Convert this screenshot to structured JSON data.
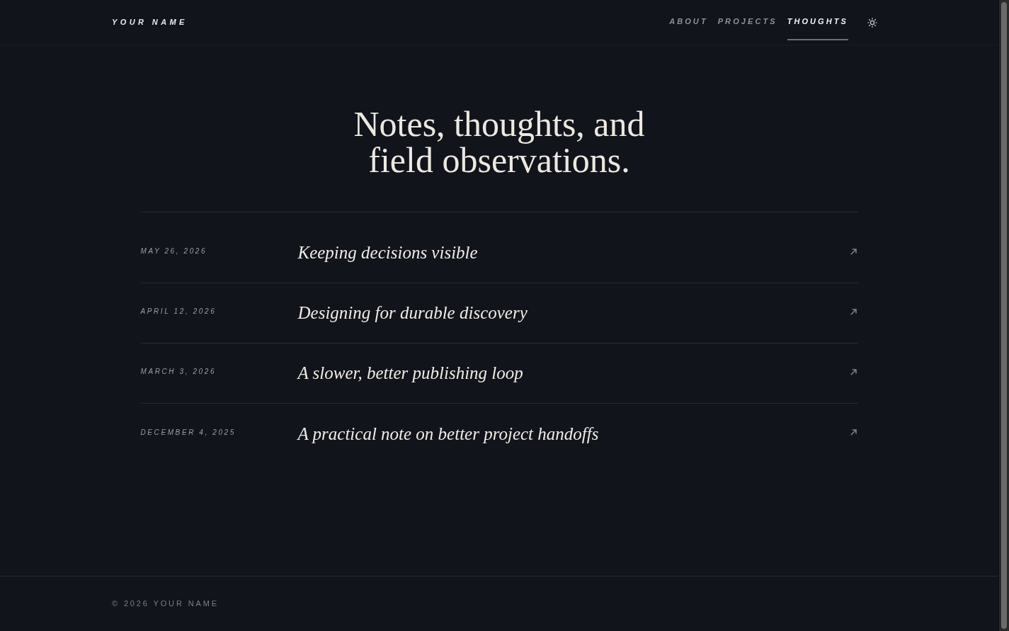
{
  "header": {
    "logo": "YOUR NAME",
    "nav": [
      {
        "label": "ABOUT",
        "selected": false
      },
      {
        "label": "PROJECTS",
        "selected": false
      },
      {
        "label": "THOUGHTS",
        "selected": true
      }
    ]
  },
  "hero": {
    "title": "Notes, thoughts, and field observations."
  },
  "posts": [
    {
      "date": "MAY 26, 2026",
      "title": "Keeping decisions visible"
    },
    {
      "date": "APRIL 12, 2026",
      "title": "Designing for durable discovery"
    },
    {
      "date": "MARCH 3, 2026",
      "title": "A slower, better publishing loop"
    },
    {
      "date": "DECEMBER 4, 2025",
      "title": "A practical note on better project handoffs"
    }
  ],
  "footer": {
    "copyright": "© 2026 YOUR NAME"
  }
}
